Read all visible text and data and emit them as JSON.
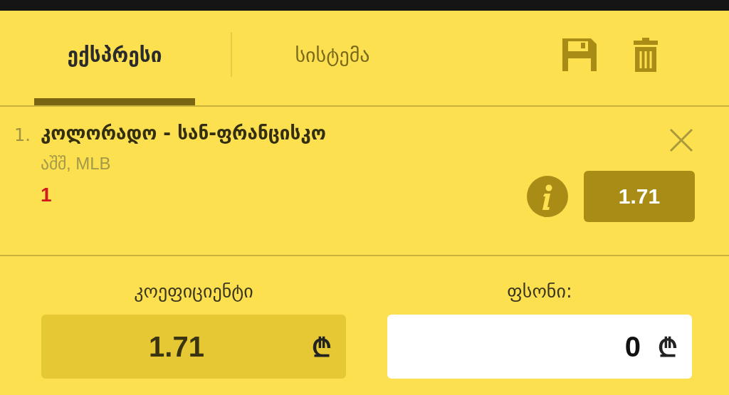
{
  "tabs": [
    {
      "label": "ექსპრესი",
      "selected": true
    },
    {
      "label": "სისტემა",
      "selected": false
    }
  ],
  "bets": [
    {
      "index": "1.",
      "match": "კოლორადო - სან-ფრანცისკო",
      "league": "აშშ, MLB",
      "pick": "1",
      "odds": "1.71"
    }
  ],
  "summary": {
    "odds_label": "კოეფიციენტი",
    "odds_value": "1.71",
    "odds_currency": "₾",
    "stake_label": "ფსონი:",
    "stake_value": "0",
    "stake_currency": "₾"
  }
}
